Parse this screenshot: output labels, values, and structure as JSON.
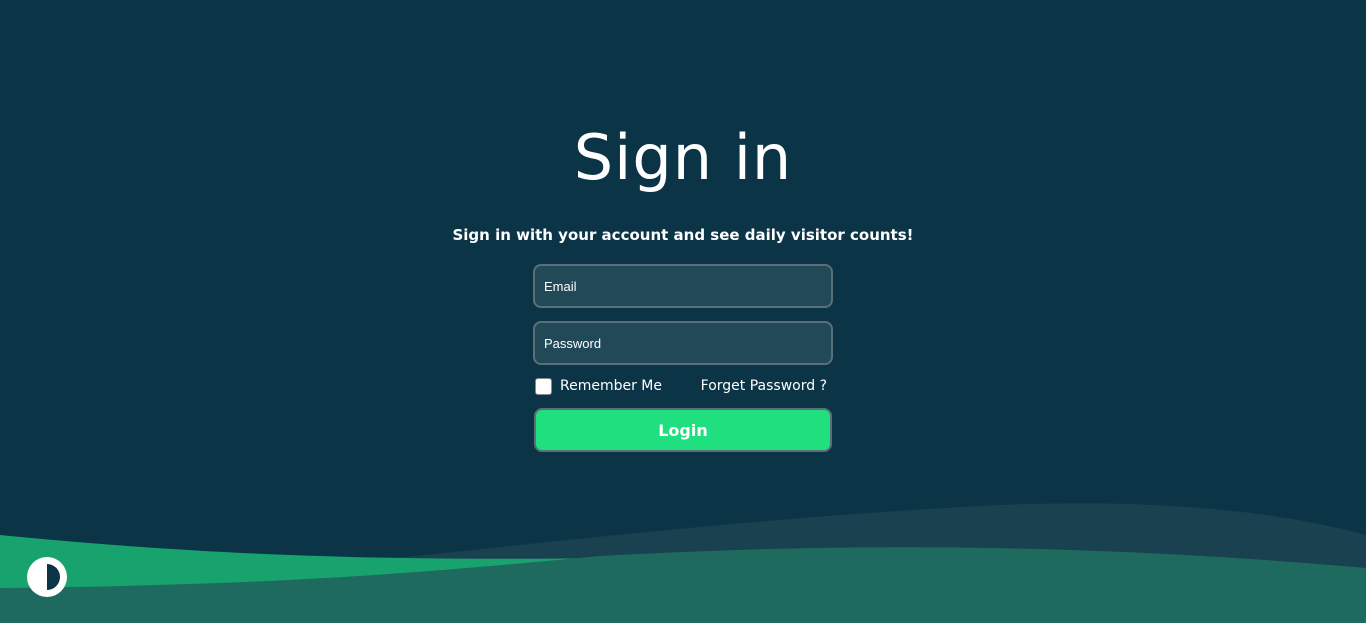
{
  "colors": {
    "background": "#0b3547",
    "wave_back": "#1a4150",
    "wave_green": "#18a36e",
    "wave_front": "#1f6a5e",
    "input_bg": "#224957",
    "accent": "#20df7f",
    "text": "#ffffff"
  },
  "signin": {
    "title": "Sign in",
    "subtitle": "Sign in with your account and see daily visitor counts!",
    "email_placeholder": "Email",
    "password_placeholder": "Password",
    "remember_label": "Remember Me",
    "forget_label": "Forget Password ?",
    "login_label": "Login"
  },
  "theme_toggle": {
    "icon": "contrast-icon"
  }
}
